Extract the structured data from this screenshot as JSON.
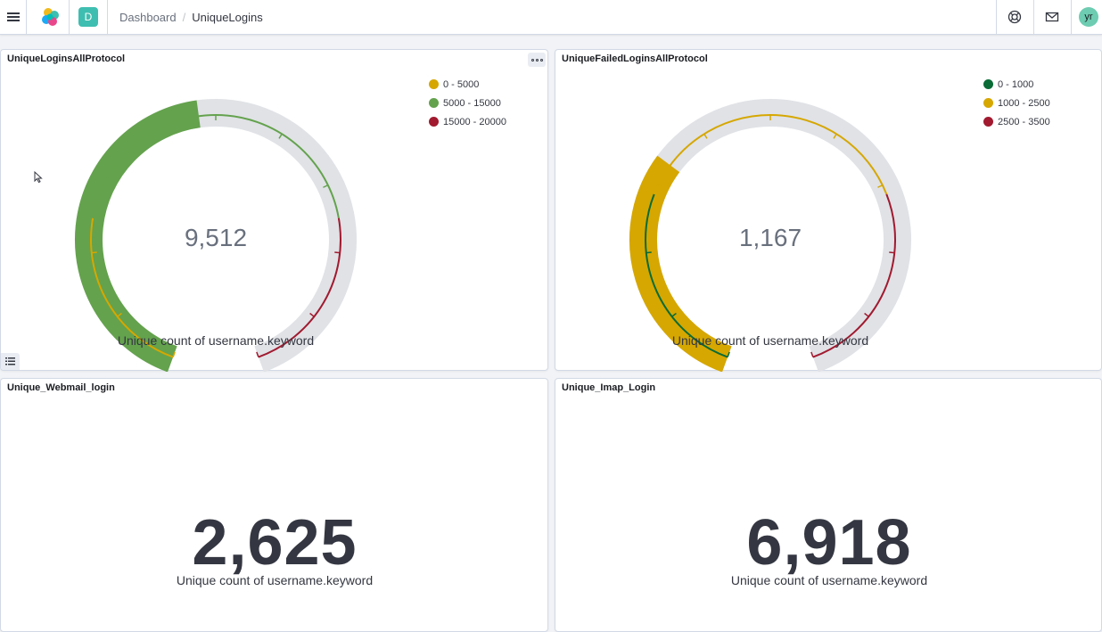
{
  "header": {
    "space_initial": "D",
    "breadcrumb_parent": "Dashboard",
    "breadcrumb_current": "UniqueLogins",
    "user_initials": "yr"
  },
  "panels": {
    "gauge1": {
      "title": "UniqueLoginsAllProtocol",
      "value": "9,512",
      "label": "Unique count of username.keyword",
      "legend": [
        {
          "label": "0 - 5000",
          "color": "#d6a700"
        },
        {
          "label": "5000 - 15000",
          "color": "#64a24d"
        },
        {
          "label": "15000 - 20000",
          "color": "#a11a2f"
        }
      ]
    },
    "gauge2": {
      "title": "UniqueFailedLoginsAllProtocol",
      "value": "1,167",
      "label": "Unique count of username.keyword",
      "legend": [
        {
          "label": "0 - 1000",
          "color": "#0a6b36"
        },
        {
          "label": "1000 - 2500",
          "color": "#d6a700"
        },
        {
          "label": "2500 - 3500",
          "color": "#a11a2f"
        }
      ]
    },
    "metric1": {
      "title": "Unique_Webmail_login",
      "value": "2,625",
      "label": "Unique count of username.keyword"
    },
    "metric2": {
      "title": "Unique_Imap_Login",
      "value": "6,918",
      "label": "Unique count of username.keyword"
    }
  },
  "chart_data": [
    {
      "type": "gauge",
      "title": "UniqueLoginsAllProtocol",
      "value": 9512,
      "range": [
        0,
        20000
      ],
      "bands": [
        {
          "from": 0,
          "to": 5000,
          "color": "#d6a700"
        },
        {
          "from": 5000,
          "to": 15000,
          "color": "#64a24d"
        },
        {
          "from": 15000,
          "to": 20000,
          "color": "#a11a2f"
        }
      ],
      "fill_color": "#64a24d",
      "label": "Unique count of username.keyword"
    },
    {
      "type": "gauge",
      "title": "UniqueFailedLoginsAllProtocol",
      "value": 1167,
      "range": [
        0,
        3500
      ],
      "bands": [
        {
          "from": 0,
          "to": 1000,
          "color": "#0a6b36"
        },
        {
          "from": 1000,
          "to": 2500,
          "color": "#d6a700"
        },
        {
          "from": 2500,
          "to": 3500,
          "color": "#a11a2f"
        }
      ],
      "fill_color": "#d6a700",
      "label": "Unique count of username.keyword"
    }
  ]
}
